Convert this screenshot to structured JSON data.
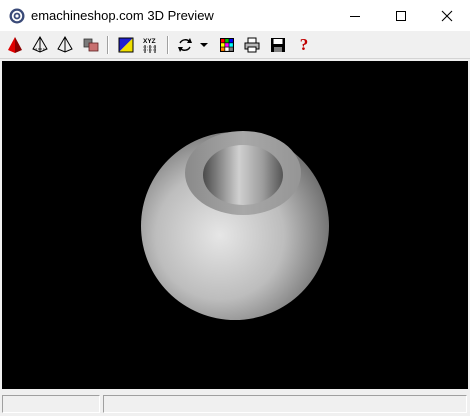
{
  "window": {
    "title": "emachineshop.com 3D Preview"
  },
  "icons": {
    "app": "emachineshop-app-icon",
    "minimize": "minimize-icon",
    "maximize": "maximize-icon",
    "close": "close-icon"
  },
  "toolbar": {
    "buttons": [
      {
        "name": "solid-view-icon"
      },
      {
        "name": "wireframe-view-icon"
      },
      {
        "name": "outline-view-icon"
      },
      {
        "name": "parts-view-icon"
      },
      {
        "name": "color-shading-icon"
      },
      {
        "name": "xyz-axes-icon",
        "label": "XYZ"
      },
      {
        "name": "rotate-icon"
      },
      {
        "name": "rotate-dropdown-icon"
      },
      {
        "name": "color-palette-icon"
      },
      {
        "name": "print-icon"
      },
      {
        "name": "save-icon"
      },
      {
        "name": "help-icon",
        "label": "?"
      }
    ]
  },
  "viewport": {
    "background": "#000000",
    "model": "sphere-with-bore"
  },
  "statusbar": {
    "pane1": "",
    "pane2": ""
  },
  "colors": {
    "help": "#c00000",
    "solid": "#d40000",
    "model_light": "#e0e0e0",
    "model_dark": "#6e6e6e"
  }
}
